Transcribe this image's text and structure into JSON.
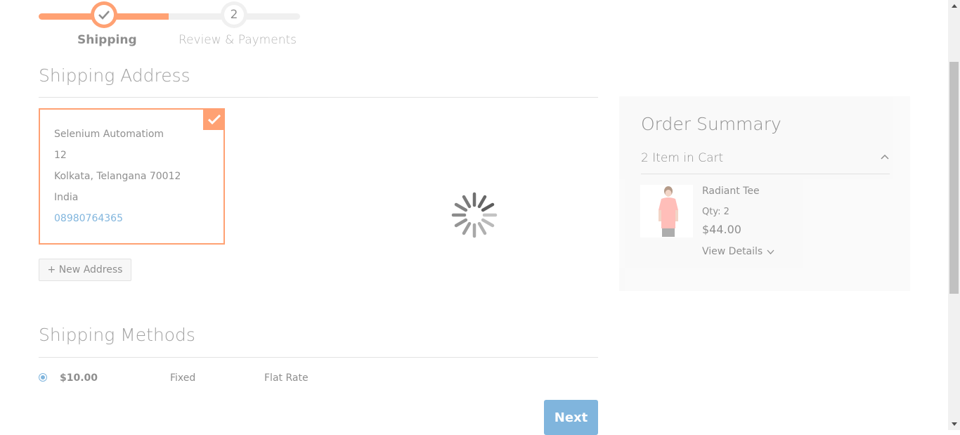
{
  "progress": {
    "steps": [
      {
        "label": "Shipping",
        "state": "complete"
      },
      {
        "label": "Review & Payments",
        "number": "2",
        "state": "pending"
      }
    ]
  },
  "shipping_address": {
    "title": "Shipping Address",
    "selected": {
      "name": "Selenium Automatiom",
      "street": "12",
      "city_line": "Kolkata, Telangana 70012",
      "country": "India",
      "phone": "08980764365"
    },
    "new_address_label": "+ New Address"
  },
  "shipping_methods": {
    "title": "Shipping Methods",
    "methods": [
      {
        "price": "$10.00",
        "method": "Fixed",
        "carrier": "Flat Rate",
        "selected": true
      }
    ],
    "next_label": "Next"
  },
  "order_summary": {
    "title": "Order Summary",
    "cart_count": "2 Item in Cart",
    "items": [
      {
        "name": "Radiant Tee",
        "qty": "Qty: 2",
        "price": "$44.00",
        "details_label": "View Details"
      }
    ]
  },
  "colors": {
    "accent": "#ff5501",
    "primary": "#1979c3",
    "summary_bg": "#f5f5f5"
  },
  "loading": true
}
